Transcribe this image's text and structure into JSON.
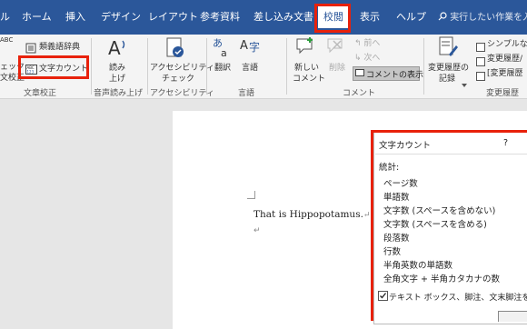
{
  "tabs": [
    {
      "label": "ル"
    },
    {
      "label": "ホーム"
    },
    {
      "label": "挿入"
    },
    {
      "label": "デザイン"
    },
    {
      "label": "レイアウト"
    },
    {
      "label": "参考資料"
    },
    {
      "label": "差し込み文書"
    },
    {
      "label": "校閲"
    },
    {
      "label": "表示"
    },
    {
      "label": "ヘルプ"
    }
  ],
  "search_placeholder": "実行したい作業を入力",
  "ribbon": {
    "proofing": {
      "spelling_top": "ABC",
      "spelling_l1": "ェック",
      "spelling_l2": "文校正",
      "thesaurus": "類義語辞典",
      "word_count": "文字カウント",
      "group": "文章校正"
    },
    "speech": {
      "l1": "読み",
      "l2": "上げ",
      "group": "音声読み上げ"
    },
    "accessibility": {
      "l1": "アクセシビリティ",
      "l2": "チェック",
      "group": "アクセシビリティ"
    },
    "language": {
      "translate": "翻訳",
      "language": "言語",
      "group": "言語"
    },
    "comments": {
      "new_l1": "新しい",
      "new_l2": "コメント",
      "delete": "削除",
      "prev": "前へ",
      "next": "次へ",
      "show": "コメントの表示",
      "group": "コメント"
    },
    "tracking": {
      "track_l1": "変更履歴の",
      "track_l2": "記録",
      "simple": "シンプルな",
      "changes1": "変更履歴/",
      "changes2": "[変更履歴",
      "group": "変更履歴"
    }
  },
  "document": {
    "text": "That is Hippopotamus.",
    "para_mark": "↵",
    "empty_mark": "↵"
  },
  "dialog": {
    "title": "文字カウント",
    "help": "?",
    "stats_label": "統計:",
    "rows": [
      "ページ数",
      "単語数",
      "文字数 (スペースを含めない)",
      "文字数 (スペースを含める)",
      "段落数",
      "行数",
      "半角英数の単語数",
      "全角文字 + 半角カタカナの数"
    ],
    "checkbox_label": "テキスト ボックス、脚注、文末脚注を含め",
    "checkbox_checked": true
  },
  "colors": {
    "accent": "#2b579a",
    "highlight": "#e8210b"
  }
}
